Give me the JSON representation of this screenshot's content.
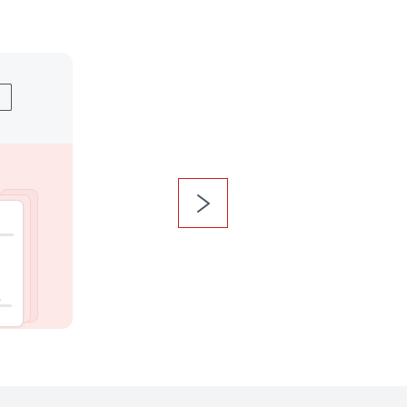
{
  "colors": {
    "accent_red": "#c81e1e",
    "card_pink": "#fde9e8",
    "card_gray": "#f6f7f9",
    "chevron": "#4a5563"
  },
  "card": {
    "top_icon": "rectangle-outline-icon",
    "bottom_illustration": "stacked-cards-icon"
  },
  "navigation": {
    "next_icon": "chevron-right-icon"
  }
}
